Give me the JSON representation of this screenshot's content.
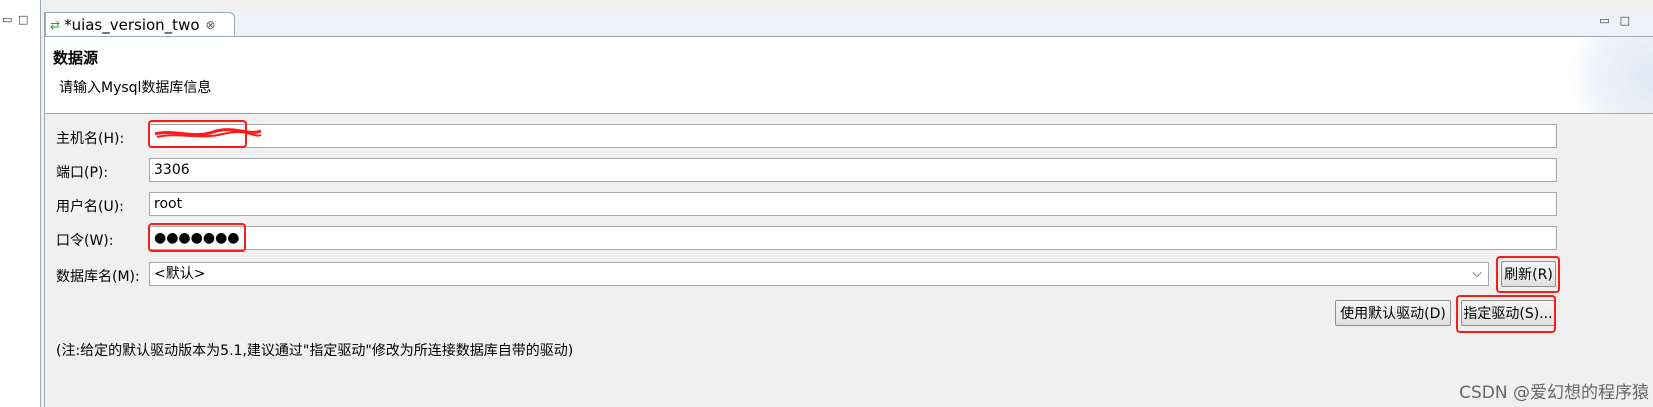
{
  "editor": {
    "tab_title": "*uias_version_two",
    "tab_close": "⊗"
  },
  "header": {
    "title": "数据源",
    "description": "请输入Mysql数据库信息"
  },
  "form": {
    "host": {
      "label": "主机名(H):",
      "value": ""
    },
    "port": {
      "label": "端口(P):",
      "value": "3306"
    },
    "user": {
      "label": "用户名(U):",
      "value": "root"
    },
    "password": {
      "label": "口令(W):",
      "value": "●●●●●●●"
    },
    "database": {
      "label": "数据库名(M):",
      "value": "<默认>"
    }
  },
  "buttons": {
    "refresh": "刷新(R)",
    "default_driver": "使用默认驱动(D)",
    "specify_driver": "指定驱动(S)..."
  },
  "note": "(注:给定的默认驱动版本为5.1,建议通过\"指定驱动\"修改为所连接数据库自带的驱动)",
  "watermark": "CSDN @爱幻想的程序猿",
  "annotation_color": "#ff1a1a",
  "icons": [
    "switch-arrows-icon",
    "close-icon",
    "minimize-icon",
    "maximize-icon",
    "chevron-down-icon"
  ]
}
